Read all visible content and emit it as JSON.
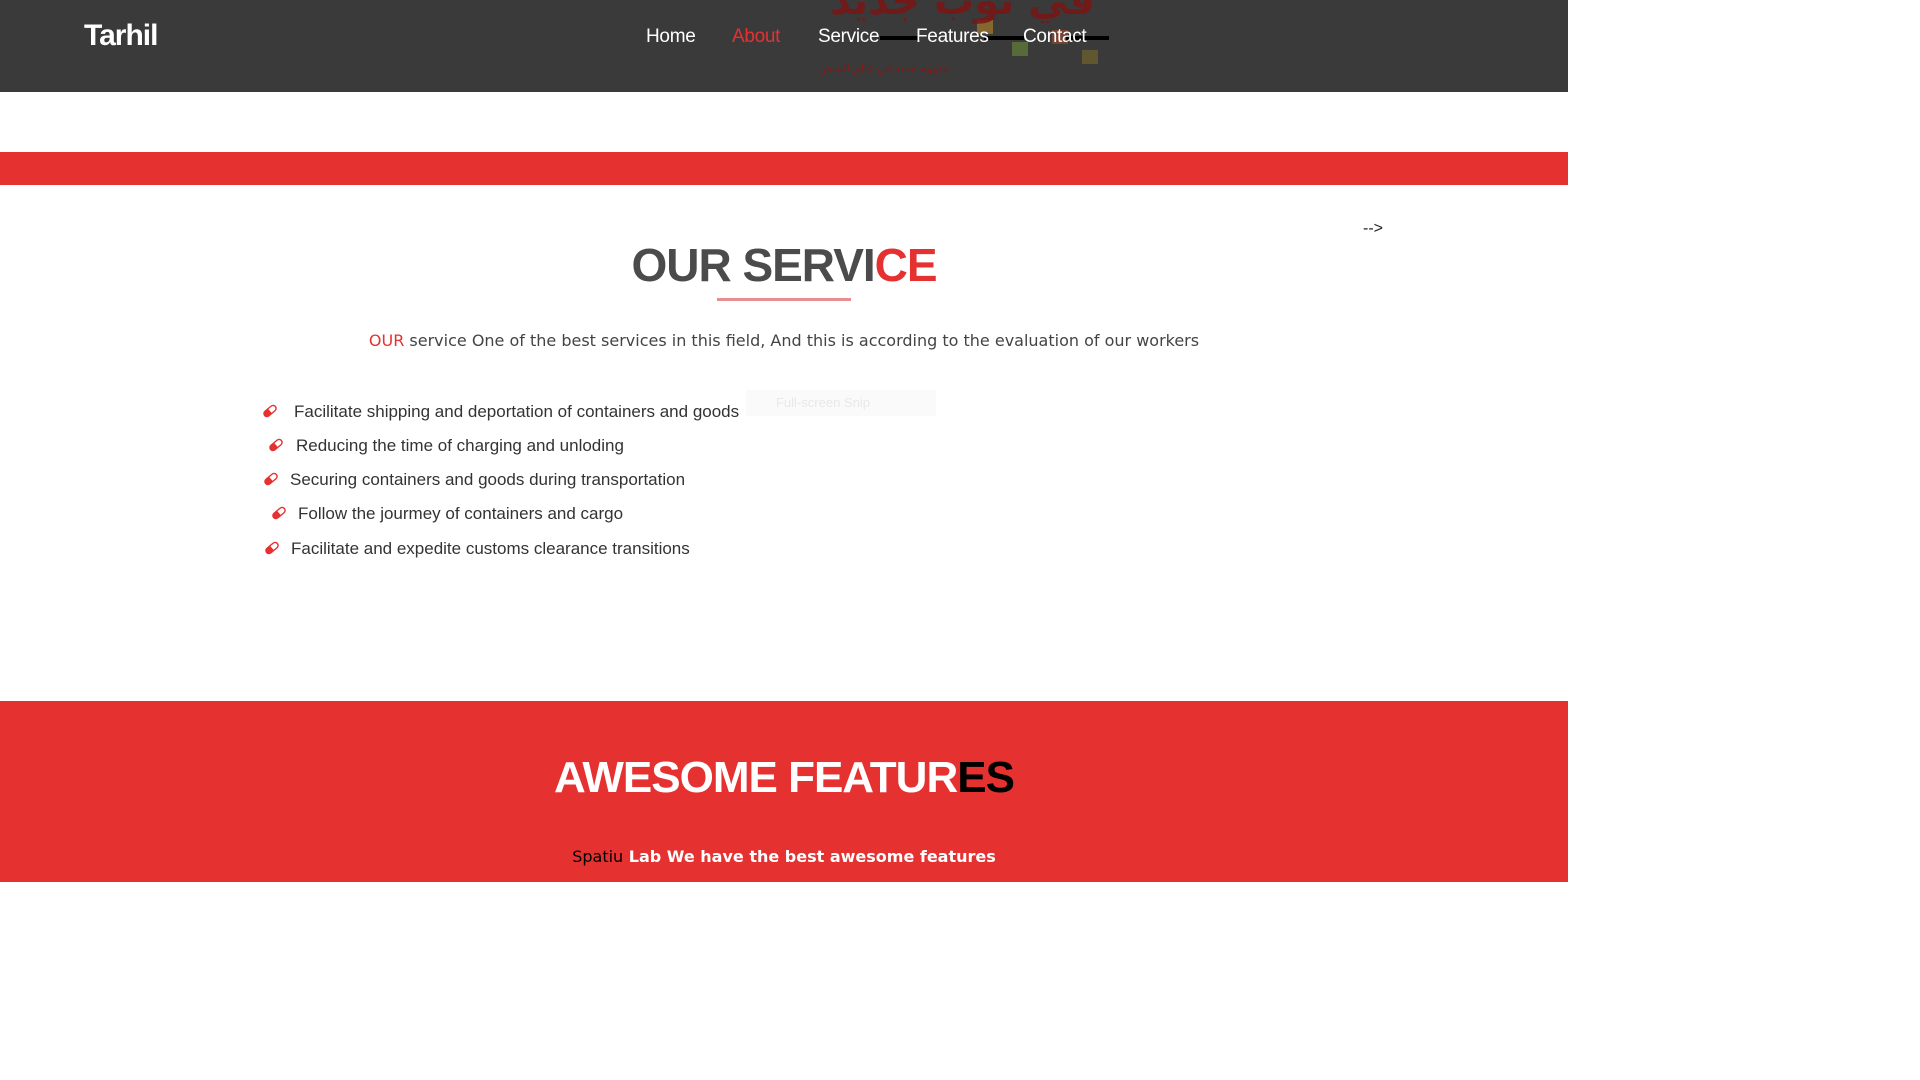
{
  "header": {
    "logo": "Tarhil",
    "nav": [
      "Home",
      "About",
      "Service",
      "Features",
      "Contact"
    ],
    "active_nav": "About",
    "hero_arabic_heading": "في ثوب جديد",
    "hero_arabic_tagline": "مفهوم جديد في عالم الشحن"
  },
  "stray_text": "-->",
  "service": {
    "title_main": "OUR SERVI",
    "title_accent": "CE",
    "subtitle_accent": "OUR",
    "subtitle_rest": " service One of the best services in this field, And this is according to the evaluation of our workers",
    "snip_label": "Full-screen Snip",
    "items": [
      "Facilitate shipping and deportation of containers and goods",
      "Reducing the time of charging and unloding",
      "Securing containers and goods during transportation",
      "Follow the jourmey of containers and cargo",
      "Facilitate and expedite customs clearance transitions"
    ],
    "item_icon": "pill-icon"
  },
  "features": {
    "title_main": "AWESOME FEATUR",
    "title_dark": "ES",
    "subtitle_dark": "Spatiu",
    "subtitle_rest": " Lab We have the best awesome features"
  },
  "colors": {
    "accent": "#e63131",
    "header_bg": "#3a3a3a",
    "text": "#4b4b4b"
  }
}
